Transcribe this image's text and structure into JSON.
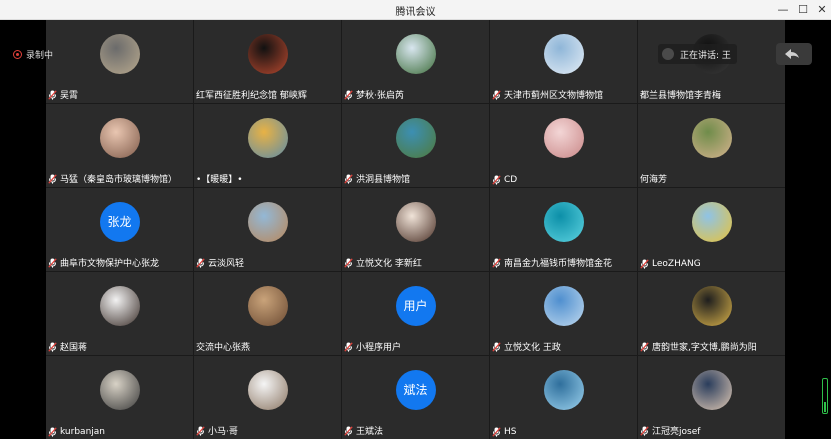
{
  "window": {
    "title": "腾讯会议"
  },
  "recording": {
    "label": "录制中"
  },
  "speaking": {
    "label": "正在讲话: 王"
  },
  "participants": [
    {
      "name": "吴霄",
      "mic": true,
      "avatar": {
        "type": "photo",
        "c1": "#6b6b6b",
        "c2": "#b8a98e"
      }
    },
    {
      "name": "红军西征胜利纪念馆 郁峡辉",
      "mic": false,
      "avatar": {
        "type": "photo",
        "c1": "#111111",
        "c2": "#b9492f"
      }
    },
    {
      "name": "梦秋·张启芮",
      "mic": true,
      "avatar": {
        "type": "photo",
        "c1": "#d8e6ef",
        "c2": "#3d6d3a"
      }
    },
    {
      "name": "天津市蓟州区文物博物馆",
      "mic": true,
      "avatar": {
        "type": "photo",
        "c1": "#8fb6d8",
        "c2": "#e3ecf5"
      }
    },
    {
      "name": "都兰县博物馆李青梅",
      "mic": false,
      "avatar": {
        "type": "photo",
        "c1": "#0f0f0f",
        "c2": "#3a3a3a"
      }
    },
    {
      "name": "马猛（秦皇岛市玻璃博物馆）",
      "mic": true,
      "avatar": {
        "type": "photo",
        "c1": "#e9c6b1",
        "c2": "#7f5b4a"
      }
    },
    {
      "name": "•【暖暖】•",
      "mic": false,
      "avatar": {
        "type": "photo",
        "c1": "#e8b245",
        "c2": "#5d8ca8"
      }
    },
    {
      "name": "洪洞县博物馆",
      "mic": true,
      "avatar": {
        "type": "photo",
        "c1": "#3c8fb3",
        "c2": "#4f7a3a"
      }
    },
    {
      "name": "CD",
      "mic": true,
      "avatar": {
        "type": "photo",
        "c1": "#f3d6d6",
        "c2": "#c98787"
      }
    },
    {
      "name": "何海芳",
      "mic": false,
      "avatar": {
        "type": "photo",
        "c1": "#6f8c4a",
        "c2": "#d6b38e"
      }
    },
    {
      "name": "曲阜市文物保护中心张龙",
      "mic": true,
      "avatar": {
        "type": "text",
        "text": "张龙"
      }
    },
    {
      "name": "云淡风轻",
      "mic": true,
      "avatar": {
        "type": "photo",
        "c1": "#93b8d6",
        "c2": "#b9875a"
      }
    },
    {
      "name": "立悦文化 李新红",
      "mic": true,
      "avatar": {
        "type": "photo",
        "c1": "#f0e3d8",
        "c2": "#4a3026"
      }
    },
    {
      "name": "南昌金九福钱币博物馆金花",
      "mic": true,
      "avatar": {
        "type": "photo",
        "c1": "#0c8fa8",
        "c2": "#5dd3e0"
      }
    },
    {
      "name": "LeoZHANG",
      "mic": true,
      "avatar": {
        "type": "photo",
        "c1": "#8fc3e6",
        "c2": "#e8c33a"
      }
    },
    {
      "name": "赵国蒋",
      "mic": true,
      "avatar": {
        "type": "photo",
        "c1": "#f2f2f2",
        "c2": "#3b2f2a"
      }
    },
    {
      "name": "交流中心张燕",
      "mic": false,
      "avatar": {
        "type": "photo",
        "c1": "#c9a37a",
        "c2": "#6b4a32"
      }
    },
    {
      "name": "小程序用户",
      "mic": true,
      "avatar": {
        "type": "text",
        "text": "用户"
      }
    },
    {
      "name": "立悦文化 王政",
      "mic": true,
      "avatar": {
        "type": "photo",
        "c1": "#4f8fcf",
        "c2": "#c0d9ee"
      }
    },
    {
      "name": "唐韵世家,字文博,鹏尚为阳",
      "mic": true,
      "avatar": {
        "type": "photo",
        "c1": "#1e1e1e",
        "c2": "#d9b24a"
      }
    },
    {
      "name": "kurbanjan",
      "mic": true,
      "avatar": {
        "type": "photo",
        "c1": "#d8d2c6",
        "c2": "#3a3a3a"
      }
    },
    {
      "name": "小马·哥",
      "mic": true,
      "avatar": {
        "type": "photo",
        "c1": "#f5f5f5",
        "c2": "#8a7562"
      }
    },
    {
      "name": "王斌法",
      "mic": true,
      "avatar": {
        "type": "text",
        "text": "斌法"
      }
    },
    {
      "name": "HS",
      "mic": true,
      "avatar": {
        "type": "photo",
        "c1": "#2f6f9c",
        "c2": "#9cd2ee"
      }
    },
    {
      "name": "江冠亮josef",
      "mic": true,
      "avatar": {
        "type": "photo",
        "c1": "#2a3d5c",
        "c2": "#e0c9b5"
      }
    }
  ],
  "colors": {
    "tile": "#2b2b2b",
    "accent": "#1278f0",
    "recording": "#e0403a",
    "volume": "#2fbf4a"
  }
}
